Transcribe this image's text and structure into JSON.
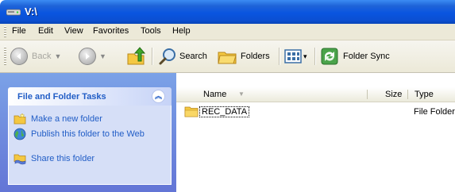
{
  "window": {
    "title": "V:\\"
  },
  "menu": [
    "File",
    "Edit",
    "View",
    "Favorites",
    "Tools",
    "Help"
  ],
  "toolbar": {
    "back_label": "Back",
    "search_label": "Search",
    "folders_label": "Folders",
    "folder_sync_label": "Folder Sync"
  },
  "task_panel": {
    "title": "File and Folder Tasks",
    "items": [
      {
        "label": "Make a new folder",
        "icon": "new-folder-icon"
      },
      {
        "label": "Publish this folder to the Web",
        "icon": "globe-icon"
      },
      {
        "label": "Share this folder",
        "icon": "share-folder-icon"
      }
    ]
  },
  "file_list": {
    "columns": [
      "Name",
      "Size",
      "Type"
    ],
    "rows": [
      {
        "name": "REC_DATA",
        "size": "",
        "type": "File Folder"
      }
    ]
  },
  "colors": {
    "titlebar": "#0a55e0",
    "taskpane": "#7ba2e7",
    "link": "#215dc6"
  }
}
